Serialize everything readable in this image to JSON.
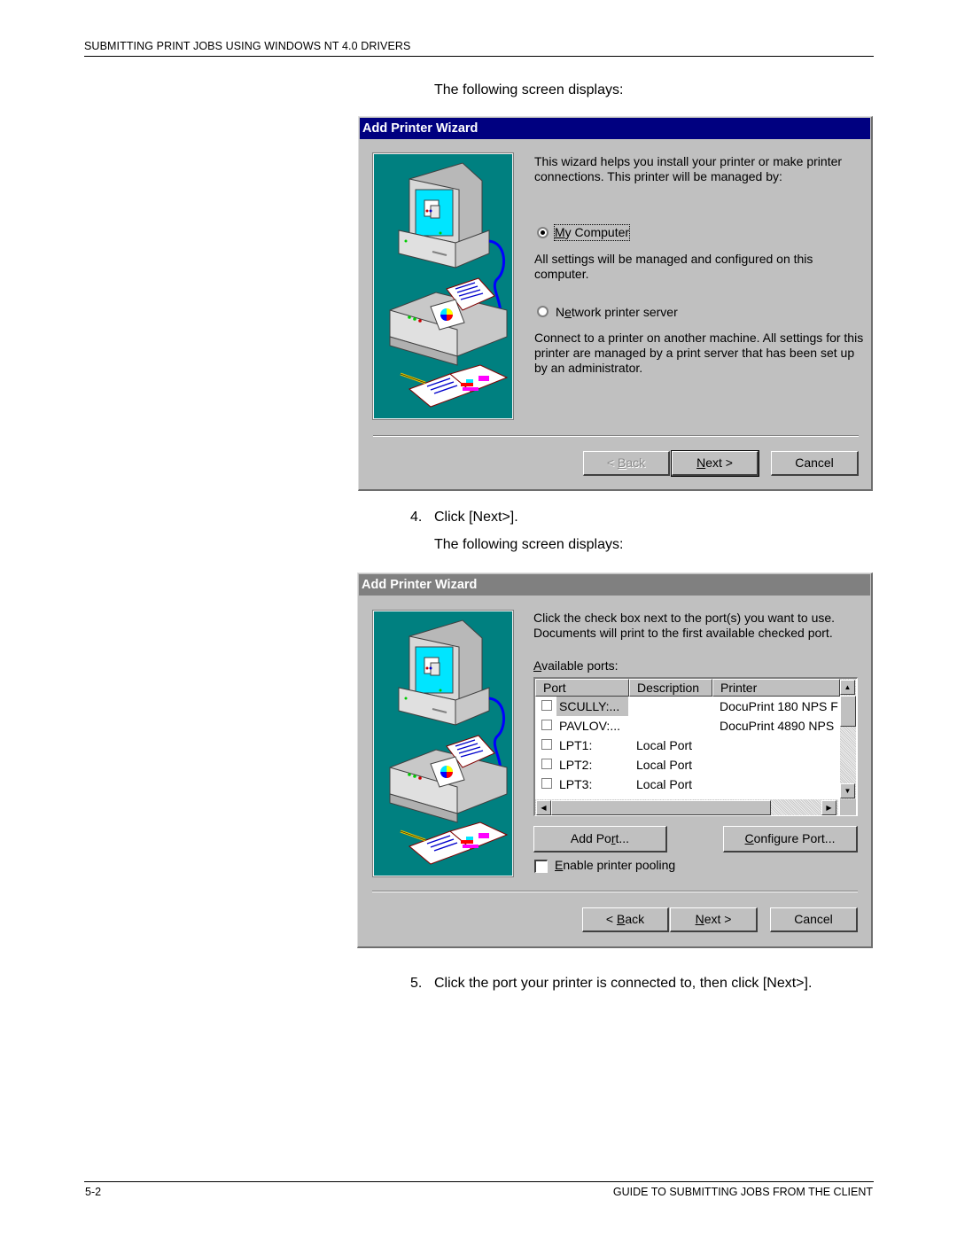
{
  "page": {
    "header": "SUBMITTING PRINT JOBS USING WINDOWS NT 4.0 DRIVERS",
    "footer_left": "5-2",
    "footer_right": "GUIDE TO SUBMITTING JOBS FROM THE CLIENT",
    "intro_1": "The following screen displays:",
    "step4_num": "4.",
    "step4_text": "Click [Next>].",
    "intro_2": "The following screen displays:",
    "step5_num": "5.",
    "step5_text": "Click the port your printer is connected to, then click [Next>]."
  },
  "dialog1": {
    "title": "Add Printer Wizard",
    "intro": "This wizard helps you install your printer or make printer connections.  This printer will be managed by:",
    "options": [
      {
        "label_prefix": "",
        "label_underline": "M",
        "label_rest": "y Computer",
        "selected": true,
        "description": "All settings will be managed and configured on this computer."
      },
      {
        "label_prefix": "N",
        "label_underline": "e",
        "label_rest": "twork printer server",
        "selected": false,
        "description": "Connect to a printer on another machine.  All settings for this printer are managed by a print server that has been set up by an administrator."
      }
    ],
    "buttons": {
      "back_pre": "< ",
      "back_u": "B",
      "back_rest": "ack",
      "next_u": "N",
      "next_rest": "ext >",
      "cancel": "Cancel"
    },
    "back_enabled": false
  },
  "dialog2": {
    "title": "Add Printer Wizard",
    "intro": "Click the check box next to the port(s) you want to use. Documents will print to the first available checked port.",
    "ports_label_u": "A",
    "ports_label_rest": "vailable ports:",
    "columns": [
      "Port",
      "Description",
      "Printer"
    ],
    "rows": [
      {
        "port": "SCULLY:...",
        "description": "",
        "printer": "DocuPrint 180 NPS F",
        "checked": false,
        "selected": true
      },
      {
        "port": "PAVLOV:...",
        "description": "",
        "printer": "DocuPrint 4890 NPS",
        "checked": false,
        "selected": false
      },
      {
        "port": "LPT1:",
        "description": "Local Port",
        "printer": "",
        "checked": false,
        "selected": false
      },
      {
        "port": "LPT2:",
        "description": "Local Port",
        "printer": "",
        "checked": false,
        "selected": false
      },
      {
        "port": "LPT3:",
        "description": "Local Port",
        "printer": "",
        "checked": false,
        "selected": false
      }
    ],
    "add_port_pre": "Add Po",
    "add_port_u": "r",
    "add_port_rest": "t...",
    "configure_port_u": "C",
    "configure_port_rest": "onfigure Port...",
    "pooling_u": "E",
    "pooling_rest": "nable printer pooling",
    "pooling_checked": false,
    "buttons": {
      "back_pre": "< ",
      "back_u": "B",
      "back_rest": "ack",
      "next_u": "N",
      "next_rest": "ext >",
      "cancel": "Cancel"
    }
  }
}
